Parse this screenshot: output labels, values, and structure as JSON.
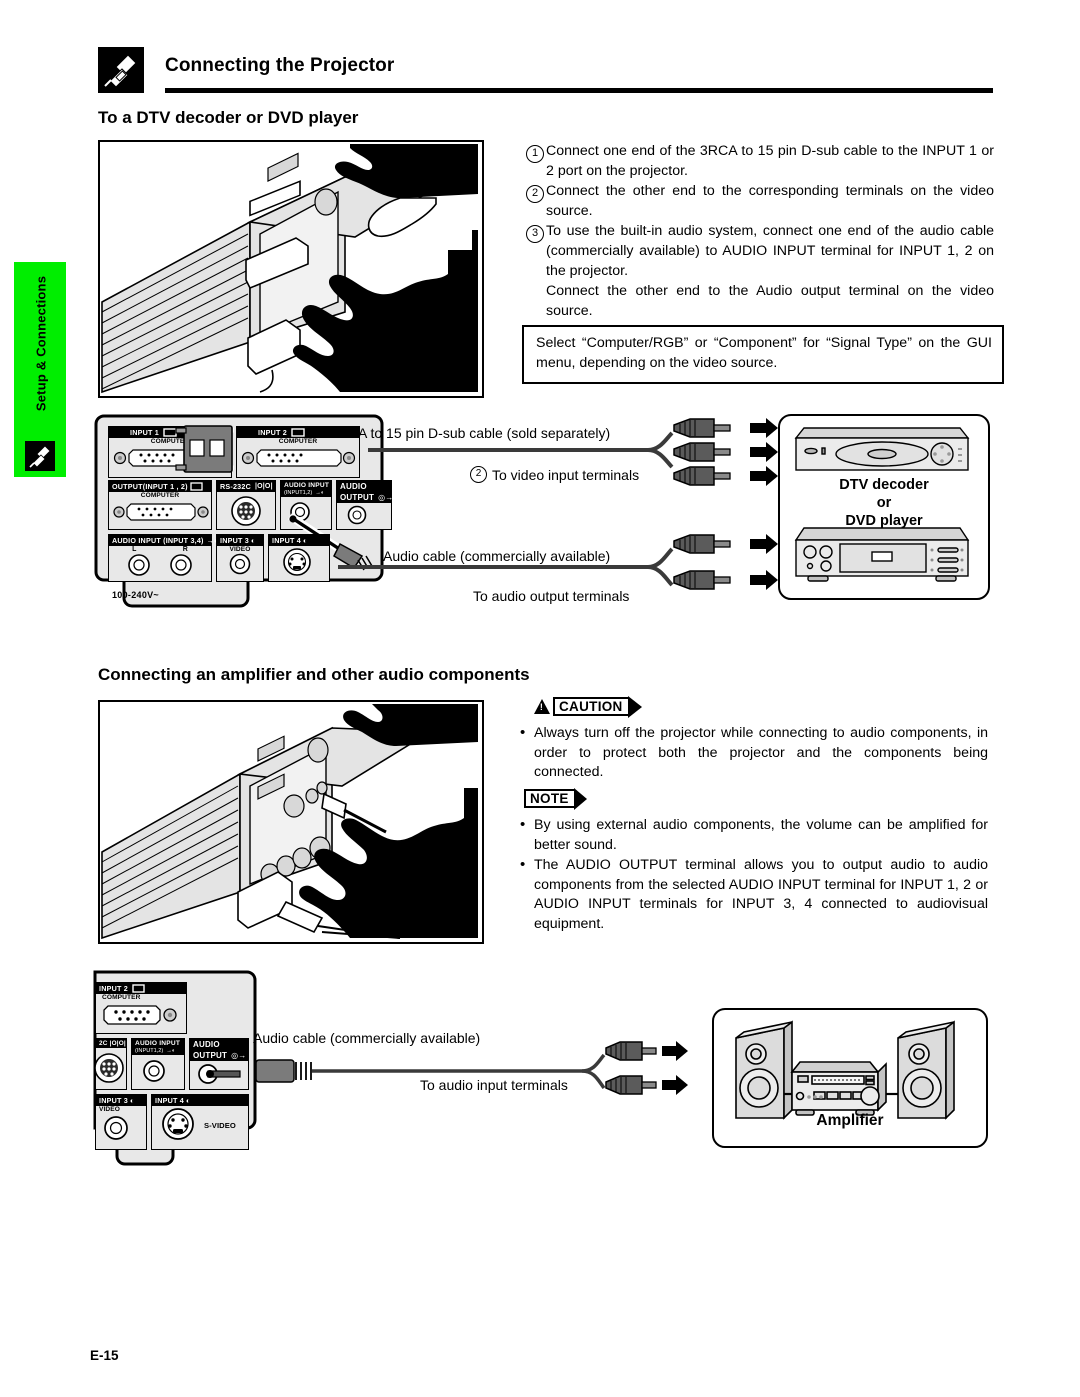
{
  "header": {
    "icon": "plug-connector-icon",
    "title": "Connecting the Projector"
  },
  "side_tab": {
    "label": "Setup & Connections",
    "color": "#00ee00",
    "icon": "plug-connector-icon"
  },
  "section1": {
    "title": "To a DTV decoder or DVD player",
    "steps": [
      {
        "num": "1",
        "text": "Connect one end of the 3RCA to 15 pin D-sub cable to the INPUT 1 or 2 port on the projector."
      },
      {
        "num": "2",
        "text": "Connect the other end to the corresponding terminals on the video source."
      },
      {
        "num": "3",
        "text": "To use the built-in audio system, connect one end of the audio cable (commercially available) to AUDIO INPUT terminal for INPUT 1, 2 on the projector."
      }
    ],
    "step3_cont": "Connect the other end to the Audio output terminal on the video source.",
    "signal_note": "Select “Computer/RGB” or “Component” for “Signal Type” on the GUI menu, depending on the video source.",
    "annotations": {
      "cable_3rca": "3RCA to 15 pin D-sub cable (sold separately)",
      "video_terminals_num": "2",
      "video_terminals": "To video input terminals",
      "audio_cable": "Audio cable (commercially available)",
      "audio_out_terminals": "To audio output terminals"
    },
    "device": {
      "line1": "DTV decoder",
      "line2": "or",
      "line3": "DVD player"
    }
  },
  "section2": {
    "title": "Connecting an amplifier and other audio components",
    "caution": {
      "badge": "CAUTION",
      "bullets": [
        "Always turn off the projector while connecting to audio components, in order to protect both the projector and the components being connected."
      ]
    },
    "note": {
      "badge": "NOTE",
      "bullets": [
        "By using external audio components, the volume can be amplified for better sound.",
        "The AUDIO OUTPUT terminal allows you to output audio to audio components from the selected AUDIO INPUT terminal for INPUT 1, 2 or AUDIO INPUT terminals for INPUT 3, 4 connected to audiovisual equipment."
      ]
    },
    "annotations": {
      "audio_cable": "Audio cable (commercially available)",
      "audio_in_terminals": "To audio input terminals"
    },
    "device": {
      "line1": "Amplifier"
    }
  },
  "panel_top": {
    "labels": {
      "input1": "INPUT 1",
      "input1_sub": "COMPUTER",
      "input2": "INPUT 2",
      "input2_sub": "COMPUTER",
      "output": "OUTPUT(INPUT 1 , 2)",
      "output_sub": "COMPUTER",
      "rs232c": "RS-232C",
      "audio_input": "AUDIO INPUT",
      "audio_input_sub": "(INPUT1,2)",
      "audio_output": "AUDIO",
      "audio_output2": "OUTPUT",
      "audio_input34": "AUDIO INPUT (INPUT 3,4)",
      "ch_l": "L",
      "ch_r": "R",
      "input3": "INPUT 3",
      "input3_sub": "VIDEO",
      "input4": "INPUT 4",
      "voltage": "100-240V~"
    }
  },
  "panel_bottom": {
    "labels": {
      "input2": "INPUT 2",
      "input2_sub": "COMPUTER",
      "rs232c": "2C",
      "audio_input": "AUDIO INPUT",
      "audio_input_sub": "(INPUT1,2)",
      "audio_output": "AUDIO",
      "audio_output2": "OUTPUT",
      "input3": "INPUT 3",
      "input3_sub": "VIDEO",
      "input4": "INPUT 4",
      "input4_sub": "S-VIDEO"
    }
  },
  "footer": {
    "page_number": "E-15"
  }
}
